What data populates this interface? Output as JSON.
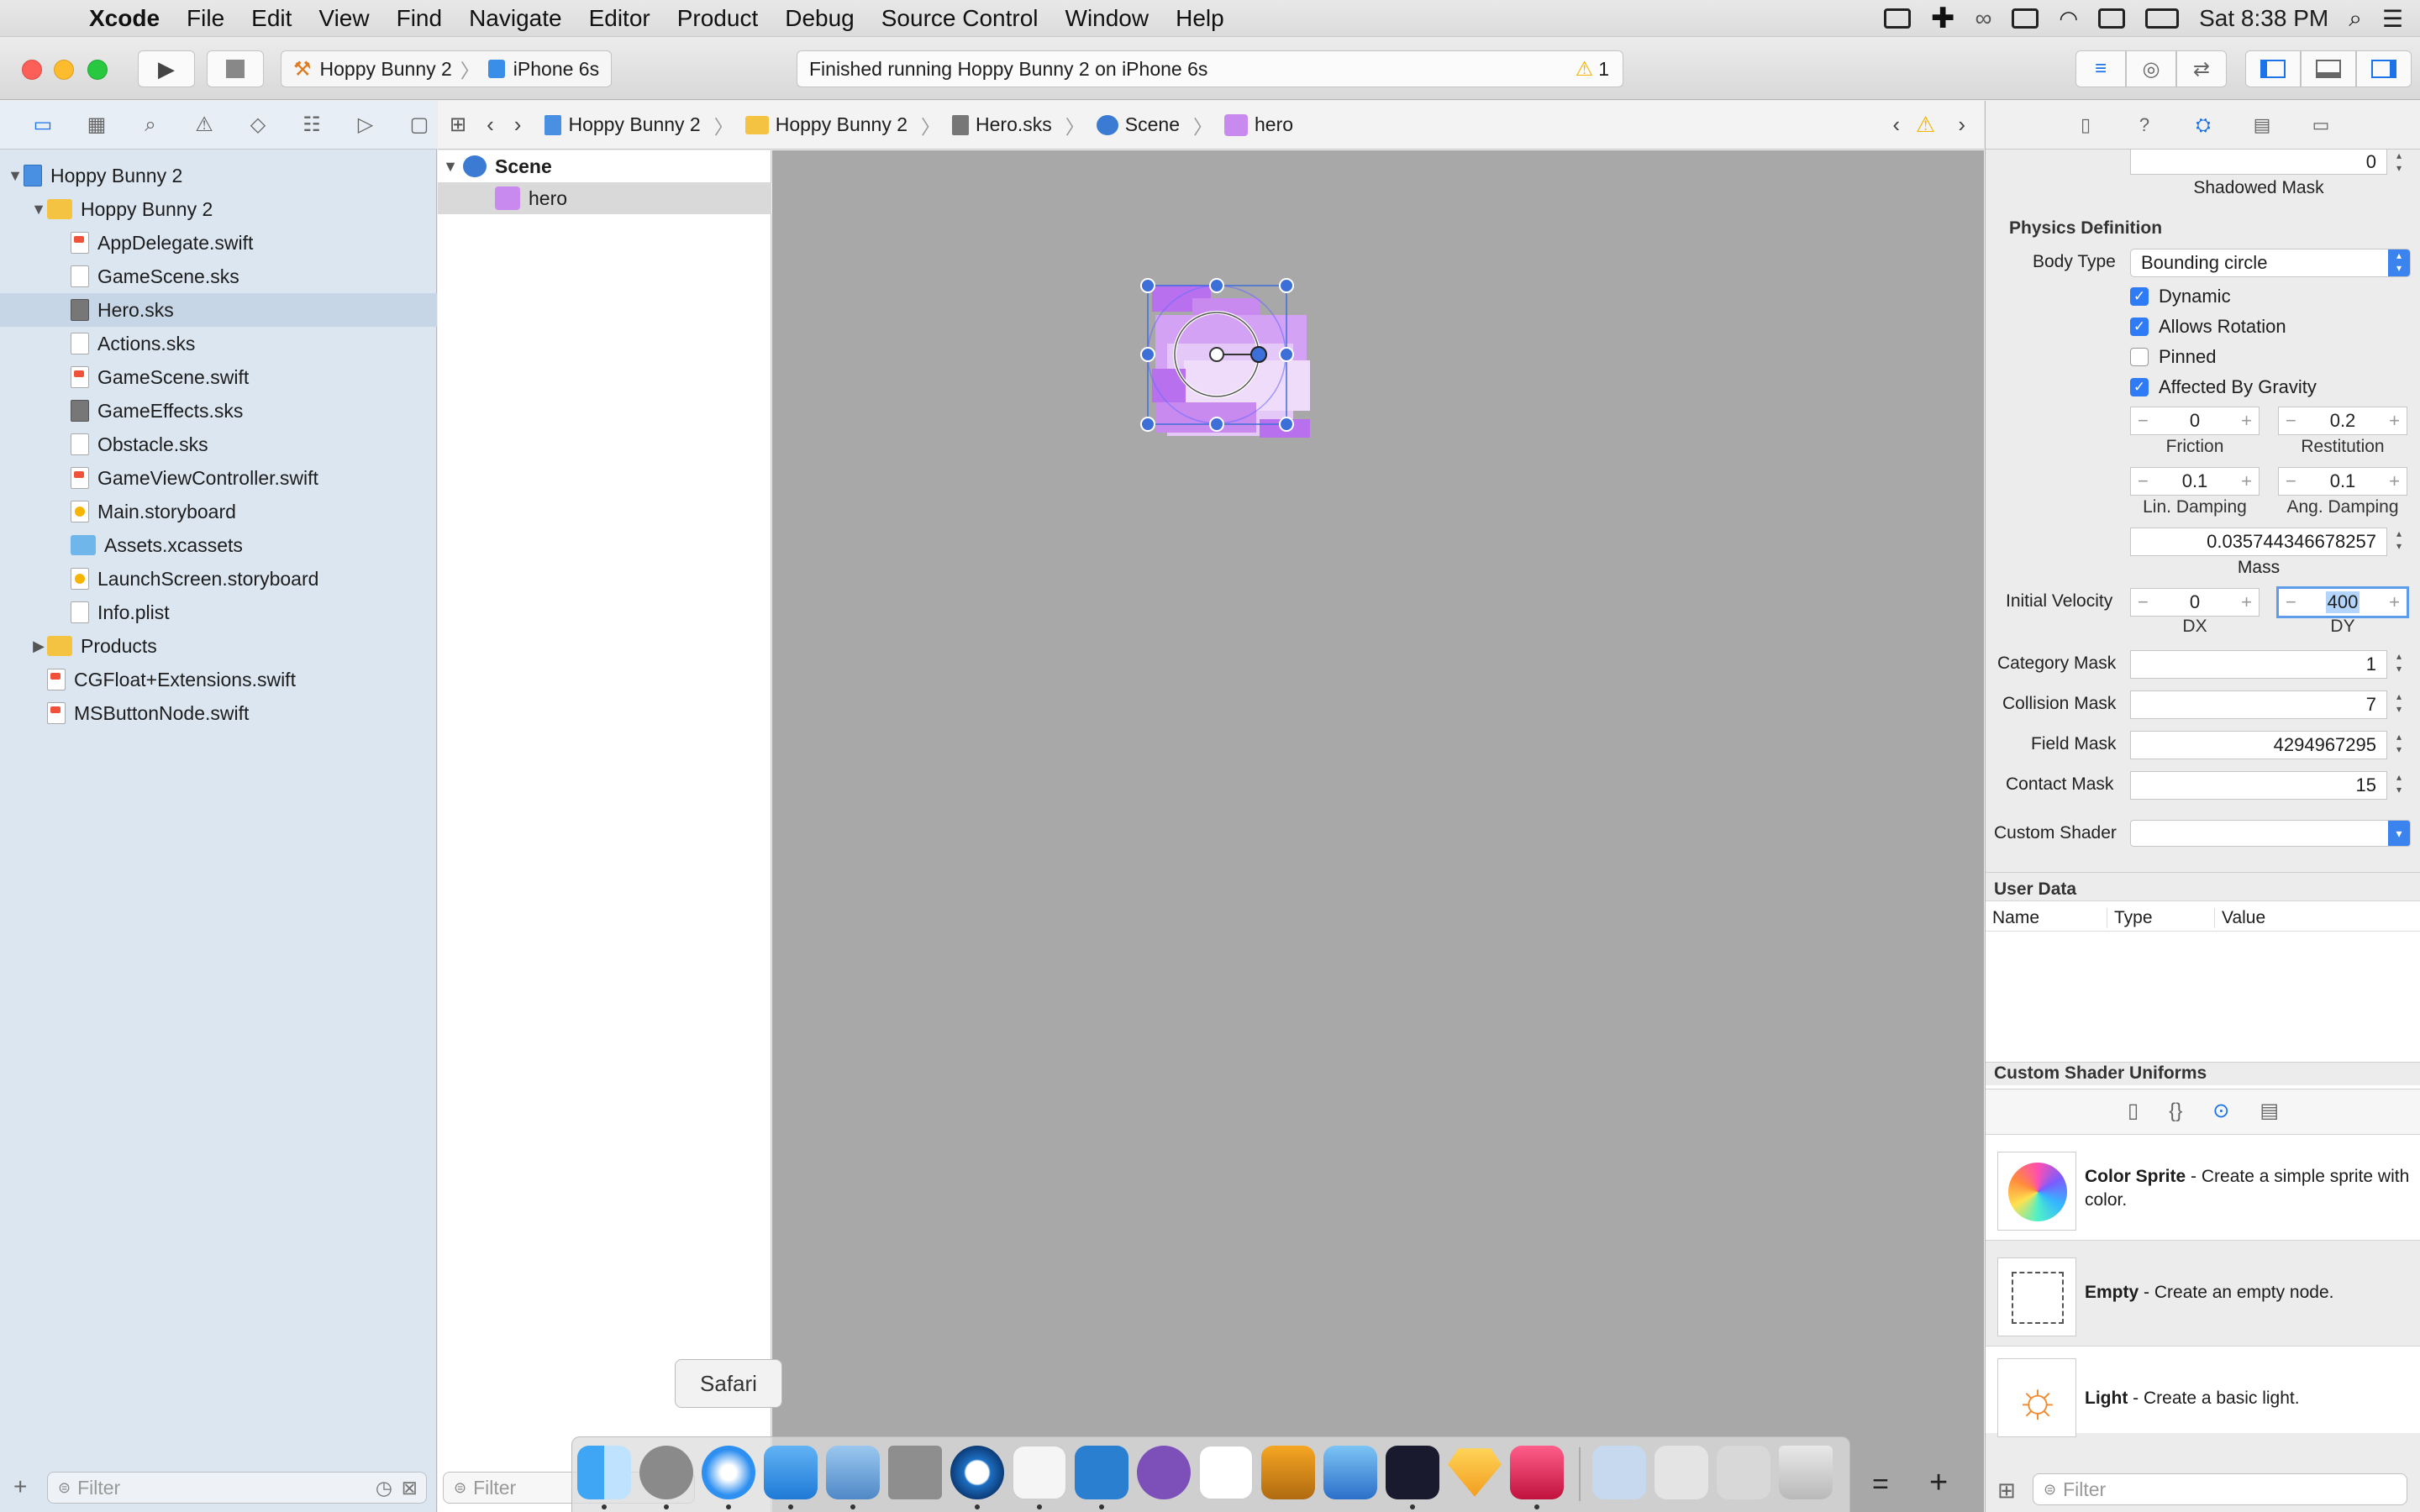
{
  "menubar": {
    "app": "Xcode",
    "items": [
      "File",
      "Edit",
      "View",
      "Find",
      "Navigate",
      "Editor",
      "Product",
      "Debug",
      "Source Control",
      "Window",
      "Help"
    ],
    "clock": "Sat 8:38 PM"
  },
  "toolbar": {
    "scheme": "Hoppy Bunny 2",
    "device": "iPhone 6s",
    "activity": "Finished running Hoppy Bunny 2 on iPhone 6s",
    "warnings": "1"
  },
  "navigator": {
    "items": [
      {
        "label": "Hoppy Bunny 2",
        "type": "proj"
      },
      {
        "label": "Hoppy Bunny 2",
        "type": "folder"
      },
      {
        "label": "AppDelegate.swift",
        "type": "swift"
      },
      {
        "label": "GameScene.sks",
        "type": "sks"
      },
      {
        "label": "Hero.sks",
        "type": "sksd"
      },
      {
        "label": "Actions.sks",
        "type": "sks"
      },
      {
        "label": "GameScene.swift",
        "type": "swift"
      },
      {
        "label": "GameEffects.sks",
        "type": "sksd"
      },
      {
        "label": "Obstacle.sks",
        "type": "sks"
      },
      {
        "label": "GameViewController.swift",
        "type": "swift"
      },
      {
        "label": "Main.storyboard",
        "type": "story"
      },
      {
        "label": "Assets.xcassets",
        "type": "assets"
      },
      {
        "label": "LaunchScreen.storyboard",
        "type": "story"
      },
      {
        "label": "Info.plist",
        "type": "plist"
      },
      {
        "label": "Products",
        "type": "folder"
      },
      {
        "label": "CGFloat+Extensions.swift",
        "type": "swift"
      },
      {
        "label": "MSButtonNode.swift",
        "type": "swift"
      }
    ],
    "filter_placeholder": "Filter"
  },
  "jumpbar": {
    "crumbs": [
      "Hoppy Bunny 2",
      "Hoppy Bunny 2",
      "Hero.sks",
      "Scene",
      "hero"
    ]
  },
  "outline": {
    "scene": "Scene",
    "node": "hero",
    "filter_placeholder": "Filter"
  },
  "inspector": {
    "shadowed_mask_value": "0",
    "shadowed_mask_label": "Shadowed Mask",
    "physics_title": "Physics Definition",
    "body_type_label": "Body Type",
    "body_type_value": "Bounding circle",
    "dynamic": "Dynamic",
    "allows_rotation": "Allows Rotation",
    "pinned": "Pinned",
    "affected_by_gravity": "Affected By Gravity",
    "friction": "0",
    "friction_label": "Friction",
    "restitution": "0.2",
    "restitution_label": "Restitution",
    "lin_damping": "0.1",
    "lin_damping_label": "Lin. Damping",
    "ang_damping": "0.1",
    "ang_damping_label": "Ang. Damping",
    "mass": "0.035744346678257",
    "mass_label": "Mass",
    "initial_velocity_label": "Initial Velocity",
    "dx": "0",
    "dx_label": "DX",
    "dy": "400",
    "dy_label": "DY",
    "category_mask_label": "Category Mask",
    "category_mask": "1",
    "collision_mask_label": "Collision Mask",
    "collision_mask": "7",
    "field_mask_label": "Field Mask",
    "field_mask": "4294967295",
    "contact_mask_label": "Contact Mask",
    "contact_mask": "15",
    "custom_shader_label": "Custom Shader",
    "user_data_title": "User Data",
    "col_name": "Name",
    "col_type": "Type",
    "col_value": "Value",
    "uniforms_title": "Custom Shader Uniforms",
    "library": [
      {
        "title": "Color Sprite",
        "desc": " - Create a simple sprite with color."
      },
      {
        "title": "Empty",
        "desc": " - Create an empty node."
      },
      {
        "title": "Light",
        "desc": " - Create a basic light."
      }
    ],
    "filter_placeholder": "Filter"
  },
  "dock": {
    "tooltip": "Safari"
  },
  "colors": {
    "accent": "#2f7bf5",
    "navigator_bg": "#dce6f1",
    "canvas_bg": "#a8a8a8",
    "sprite": "#c98af0"
  }
}
